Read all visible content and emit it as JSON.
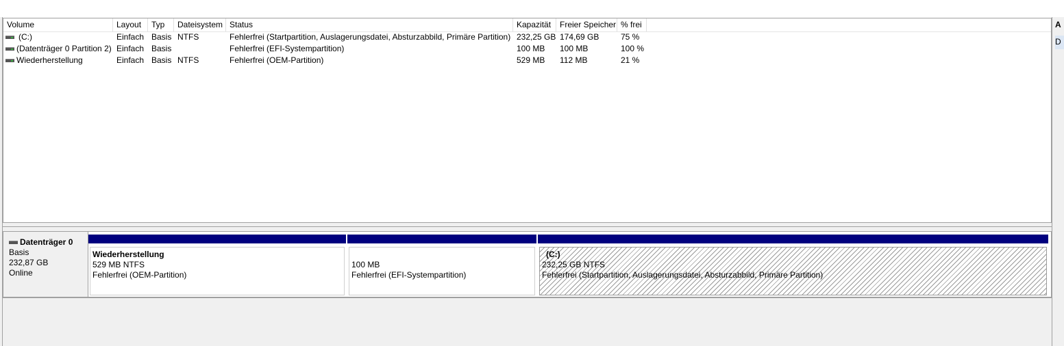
{
  "columns": [
    "Volume",
    "Layout",
    "Typ",
    "Dateisystem",
    "Status",
    "Kapazität",
    "Freier Speicher",
    "% frei"
  ],
  "volumes": [
    {
      "volume": "(C:)",
      "layout": "Einfach",
      "typ": "Basis",
      "dateisystem": "NTFS",
      "status": "Fehlerfrei (Startpartition, Auslagerungsdatei, Absturzabbild, Primäre Partition)",
      "kapazitaet": "232,25 GB",
      "frei": "174,69 GB",
      "prozent": "75 %"
    },
    {
      "volume": "(Datenträger 0 Partition 2)",
      "layout": "Einfach",
      "typ": "Basis",
      "dateisystem": "",
      "status": "Fehlerfrei (EFI-Systempartition)",
      "kapazitaet": "100 MB",
      "frei": "100 MB",
      "prozent": "100 %"
    },
    {
      "volume": "Wiederherstellung",
      "layout": "Einfach",
      "typ": "Basis",
      "dateisystem": "NTFS",
      "status": "Fehlerfrei (OEM-Partition)",
      "kapazitaet": "529 MB",
      "frei": "112 MB",
      "prozent": "21 %"
    }
  ],
  "disk": {
    "name": "Datenträger 0",
    "type": "Basis",
    "size": "232,87 GB",
    "state": "Online",
    "partitions": [
      {
        "name": "Wiederherstellung",
        "size": "529 MB NTFS",
        "status": "Fehlerfrei (OEM-Partition)"
      },
      {
        "name": "",
        "size": "100 MB",
        "status": "Fehlerfrei (EFI-Systempartition)"
      },
      {
        "name": "(C:)",
        "size": "232,25 GB NTFS",
        "status": "Fehlerfrei (Startpartition, Auslagerungsdatei, Absturzabbild, Primäre Partition)"
      }
    ]
  },
  "side_panel": {
    "tab_a": "A",
    "tab_d": "D"
  },
  "colors": {
    "partition_bar": "#00007f",
    "selection": "#dbe6f4"
  }
}
